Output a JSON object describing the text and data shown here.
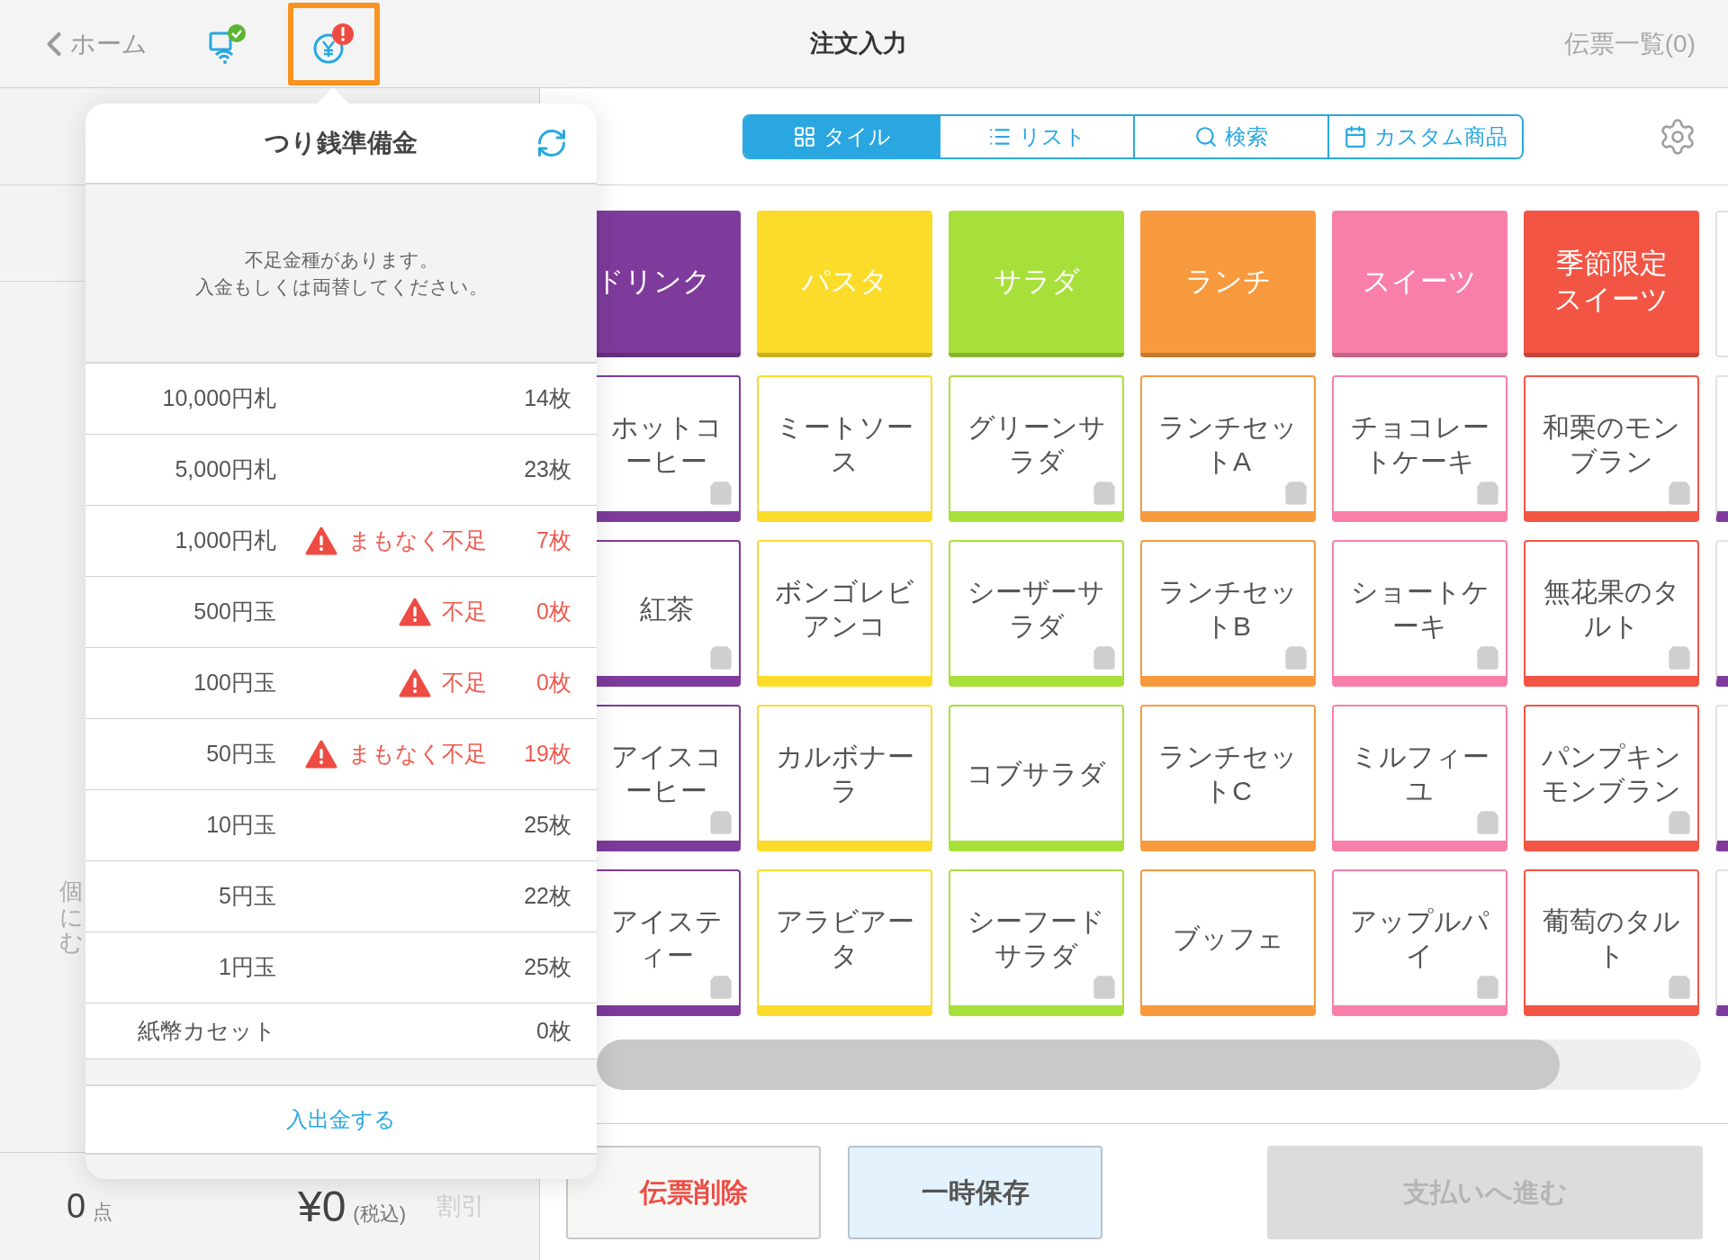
{
  "top_bar": {
    "back_label": "ホーム",
    "change_fund_button": {
      "selected": true,
      "alert": true
    },
    "title": "注文入力",
    "slips_link": "伝票一覧(0)"
  },
  "view_tabs": [
    {
      "label": "タイル",
      "kind": "grid",
      "selected": true
    },
    {
      "label": "リスト",
      "kind": "list",
      "selected": false
    },
    {
      "label": "検索",
      "kind": "search",
      "selected": false
    },
    {
      "label": "カスタム商品",
      "kind": "custom",
      "selected": false
    }
  ],
  "categories": [
    {
      "label": "ドリンク",
      "color": "#7e3b9b",
      "items": [
        {
          "label": "ホットコーヒー",
          "bag": true
        },
        {
          "label": "紅茶",
          "bag": true
        },
        {
          "label": "アイスコーヒー",
          "bag": true
        },
        {
          "label": "アイスティー",
          "bag": true
        }
      ]
    },
    {
      "label": "パスタ",
      "color": "#fbdc2b",
      "items": [
        {
          "label": "ミートソース",
          "bag": false
        },
        {
          "label": "ボンゴレビアンコ",
          "bag": false
        },
        {
          "label": "カルボナーラ",
          "bag": false
        },
        {
          "label": "アラビアータ",
          "bag": false
        }
      ]
    },
    {
      "label": "サラダ",
      "color": "#a8e03b",
      "items": [
        {
          "label": "グリーンサラダ",
          "bag": true
        },
        {
          "label": "シーザーサラダ",
          "bag": true
        },
        {
          "label": "コブサラダ",
          "bag": false
        },
        {
          "label": "シーフードサラダ",
          "bag": true
        }
      ]
    },
    {
      "label": "ランチ",
      "color": "#f79a3e",
      "items": [
        {
          "label": "ランチセットA",
          "bag": true
        },
        {
          "label": "ランチセットB",
          "bag": true
        },
        {
          "label": "ランチセットC",
          "bag": false
        },
        {
          "label": "ブッフェ",
          "bag": false
        }
      ]
    },
    {
      "label": "スイーツ",
      "color": "#f97fab",
      "items": [
        {
          "label": "チョコレートケーキ",
          "bag": true
        },
        {
          "label": "ショートケーキ",
          "bag": true
        },
        {
          "label": "ミルフィーユ",
          "bag": true
        },
        {
          "label": "アップルパイ",
          "bag": true
        }
      ]
    },
    {
      "label": "季節限定スイーツ",
      "color": "#f35544",
      "items": [
        {
          "label": "和栗のモンブラン",
          "bag": true
        },
        {
          "label": "無花果のタルト",
          "bag": true
        },
        {
          "label": "パンプキンモンブラン",
          "bag": true
        },
        {
          "label": "葡萄のタルト",
          "bag": true
        }
      ]
    }
  ],
  "left_panel": {
    "note": "個にむ",
    "count": "0",
    "count_unit": "点",
    "total": "¥0",
    "tax_note": "(税込)",
    "discount": "割引"
  },
  "actions": [
    {
      "label": "伝票削除",
      "kind": "danger",
      "disabled": false
    },
    {
      "label": "一時保存",
      "kind": "save",
      "disabled": false
    },
    {
      "label": "支払いへ進む",
      "kind": "primary",
      "disabled": true
    }
  ],
  "change_fund": {
    "title": "つり銭準備金",
    "message": [
      "不足金種があります。",
      "入金もしくは両替してください。"
    ],
    "rows": [
      {
        "name": "10,000円札",
        "warning": false,
        "count": "14枚"
      },
      {
        "name": "5,000円札",
        "warning": false,
        "count": "23枚"
      },
      {
        "name": "1,000円札",
        "warning": true,
        "status": "まもなく不足",
        "count": "7枚"
      },
      {
        "name": "500円玉",
        "warning": true,
        "status": "不足",
        "count": "0枚"
      },
      {
        "name": "100円玉",
        "warning": true,
        "status": "不足",
        "count": "0枚"
      },
      {
        "name": "50円玉",
        "warning": true,
        "status": "まもなく不足",
        "count": "19枚"
      },
      {
        "name": "10円玉",
        "warning": false,
        "count": "25枚"
      },
      {
        "name": "5円玉",
        "warning": false,
        "count": "22枚"
      },
      {
        "name": "1円玉",
        "warning": false,
        "count": "25枚"
      },
      {
        "name": "紙幣カセット",
        "warning": false,
        "count": "0枚"
      }
    ],
    "action": "入出金する"
  }
}
